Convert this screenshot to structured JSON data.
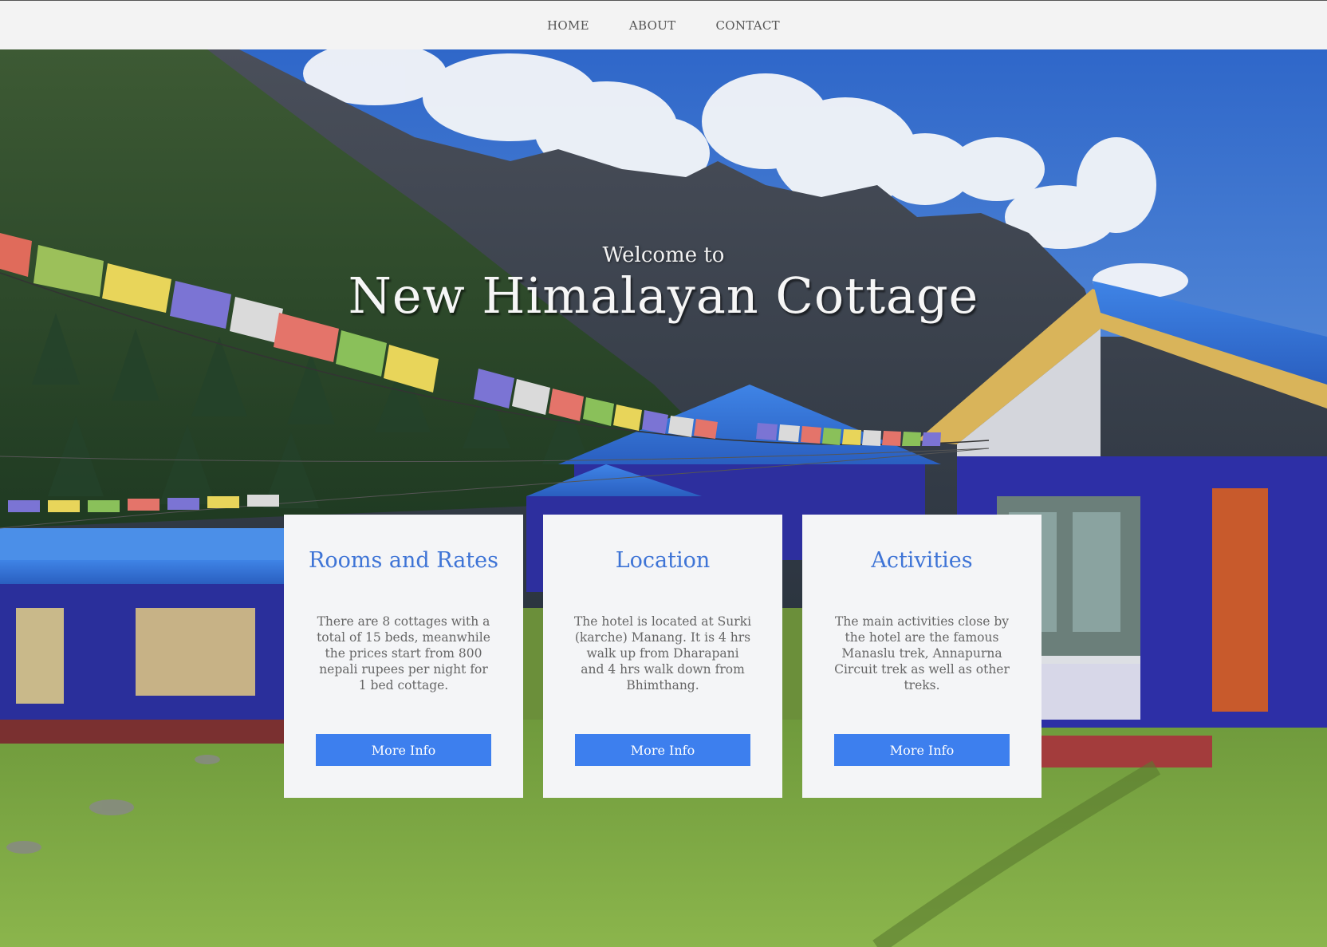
{
  "nav": {
    "items": [
      {
        "label": "HOME"
      },
      {
        "label": "ABOUT"
      },
      {
        "label": "CONTACT"
      }
    ]
  },
  "hero": {
    "welcome": "Welcome to",
    "title": "New Himalayan Cottage"
  },
  "cards": [
    {
      "heading": "Rooms and Rates",
      "text": "There are 8 cottages with a total of 15 beds, meanwhile the prices start from 800 nepali rupees per night for 1 bed cottage.",
      "button": "More Info"
    },
    {
      "heading": "Location",
      "text": "The hotel is located at Surki (karche) Manang. It is 4 hrs walk up from Dharapani and 4 hrs walk down from Bhimthang.",
      "button": "More Info"
    },
    {
      "heading": "Activities",
      "text": "The main activities close by the hotel are the famous Manaslu trek, Annapurna Circuit trek as well as other treks.",
      "button": "More Info"
    }
  ],
  "colors": {
    "nav_bg": "#f3f3f3",
    "card_bg": "#f4f5f7",
    "heading": "#3e74d6",
    "button": "#3d7fee"
  }
}
